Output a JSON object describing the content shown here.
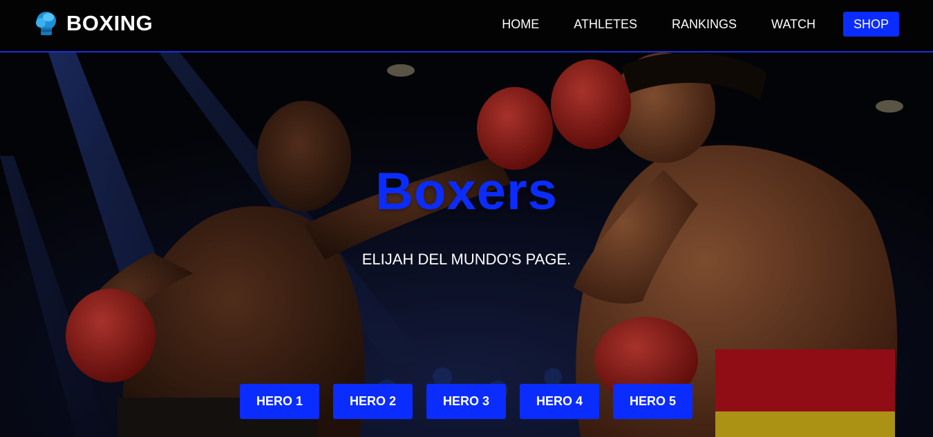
{
  "header": {
    "brand": "BOXING",
    "logo_icon": "boxing-glove-icon",
    "nav": [
      {
        "label": "HOME"
      },
      {
        "label": "ATHLETES"
      },
      {
        "label": "RANKINGS"
      },
      {
        "label": "WATCH"
      }
    ],
    "shop_label": "SHOP"
  },
  "hero": {
    "title": "Boxers",
    "subtitle": "ELIJAH DEL MUNDO'S PAGE.",
    "buttons": [
      {
        "label": "HERO 1"
      },
      {
        "label": "HERO 2"
      },
      {
        "label": "HERO 3"
      },
      {
        "label": "HERO 4"
      },
      {
        "label": "HERO 5"
      }
    ]
  },
  "colors": {
    "accent": "#0b2cff",
    "header_bg": "#030303",
    "header_border": "#1a2fe0",
    "text": "#ffffff"
  }
}
